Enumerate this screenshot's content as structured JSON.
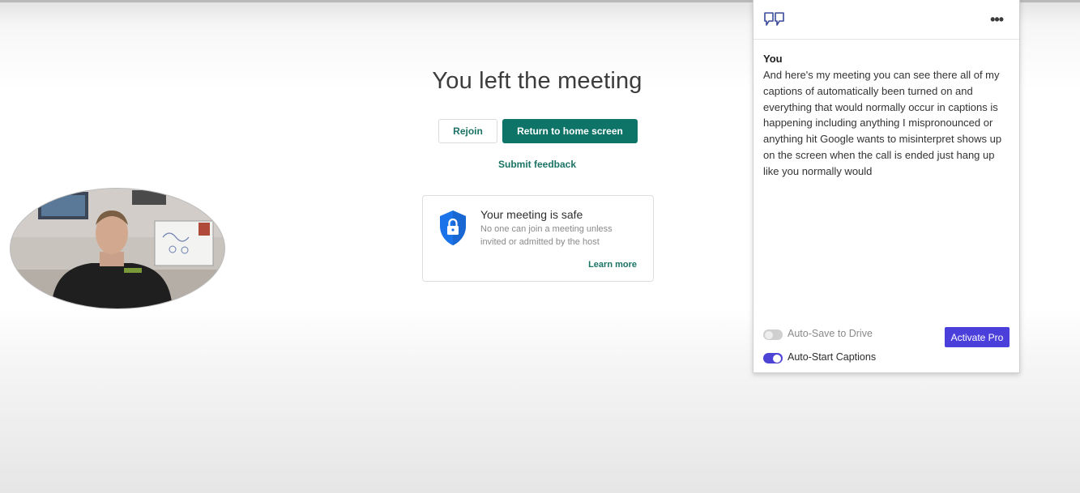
{
  "meeting": {
    "title": "You left the meeting",
    "rejoin_label": "Rejoin",
    "home_label": "Return to home screen",
    "feedback_label": "Submit feedback",
    "safety": {
      "title": "Your meeting is safe",
      "description": "No one can join a meeting unless invited or admitted by the host",
      "learn_more": "Learn more",
      "icon": "shield-lock-icon"
    }
  },
  "captions_panel": {
    "header_icon": "quote-icon",
    "menu_icon": "more-options-icon",
    "speaker": "You",
    "text": "And here's my meeting you can see there all of my captions of automatically been turned on and everything that would normally occur in captions is happening including anything I mispronounced or anything hit Google wants to misinterpret shows up on the screen when the call is ended just hang up like you normally would",
    "auto_save_label": "Auto-Save to Drive",
    "auto_save_enabled": false,
    "auto_start_label": "Auto-Start Captions",
    "auto_start_enabled": true,
    "activate_label": "Activate Pro"
  },
  "colors": {
    "accent_teal": "#0f7468",
    "shield_blue": "#1a73e8",
    "pro_purple": "#4a3fdb"
  }
}
